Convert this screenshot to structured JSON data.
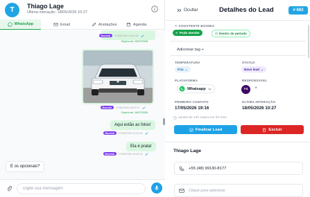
{
  "chat": {
    "avatar_initial": "T",
    "contact_name": "Thiago Lage",
    "last_interaction": "Última interação: 18/05/2026 10:27",
    "tabs": [
      {
        "label": "WhatsApp",
        "icon": "whatsapp-icon",
        "active": true
      },
      {
        "label": "Email",
        "icon": "mail-icon",
        "active": false
      },
      {
        "label": "Anotações",
        "icon": "edit-icon",
        "active": false
      },
      {
        "label": "Agenda",
        "icon": "calendar-icon",
        "active": false
      }
    ],
    "messages": [
      {
        "type": "meta",
        "tag": "BoomiA",
        "time": "17/05/2026 19:22:25",
        "expires": "Expira em: 16/07/2026"
      },
      {
        "type": "meta",
        "tag": "BoomiA",
        "time": "17/05/2026 19:22:27"
      },
      {
        "type": "image",
        "alt": "Foto do carro",
        "tag": "BoomiA",
        "time": "17/05/2026 19:22:27",
        "expires": "Expira em: 16/07/2026"
      },
      {
        "type": "text",
        "text": "Aqui estão as fotos!",
        "tag": "BoomiA",
        "time": "17/05/2026 19:22:29"
      },
      {
        "type": "text",
        "text": "Ela é prata!",
        "tag": "BoomiA",
        "time": "17/05/2026 19:22:34"
      },
      {
        "type": "incoming",
        "text": "E os opcionais?"
      }
    ],
    "composer_placeholder": "Digite sua mensagem"
  },
  "details": {
    "hide_label": "Ocultar",
    "title": "Detalhes do Lead",
    "score": "663",
    "assistant_label": "ASSISTENTE BOOMIA",
    "assistant_pills": [
      "Pode atender",
      "Dentro do período"
    ],
    "add_tag": "Adicionar tag +",
    "temperature": {
      "label": "TEMPERATURA",
      "value": "Frio"
    },
    "status": {
      "label": "STATUS",
      "value": "Novo lead"
    },
    "platform": {
      "label": "PLATAFORMA",
      "value": "Whatsapp"
    },
    "responsible": {
      "label": "RESPONSÁVEL",
      "initials": "TS",
      "add": "+"
    },
    "first_contact": {
      "label": "PRIMEIRO CONTATO",
      "value": "17/05/2026 19:16"
    },
    "last_interaction": {
      "label": "ÚLTIMA INTERAÇÃO",
      "value": "18/05/2026 10:27"
    },
    "window_note": "Janela de 24h expira em 5h 03m",
    "finish_button": "Finalizar Lead",
    "delete_button": "Excluir",
    "contact_name": "Thiago Lage",
    "phone": "+55 (48) 99130-8177",
    "email_placeholder": "Clique para adicionar"
  },
  "colors": {
    "accent": "#22a5e4",
    "whatsapp_green": "#16a34a",
    "bubble": "#d9f7e0",
    "delete_red": "#dc2626",
    "ai_tag_purple": "#7c3aed"
  }
}
